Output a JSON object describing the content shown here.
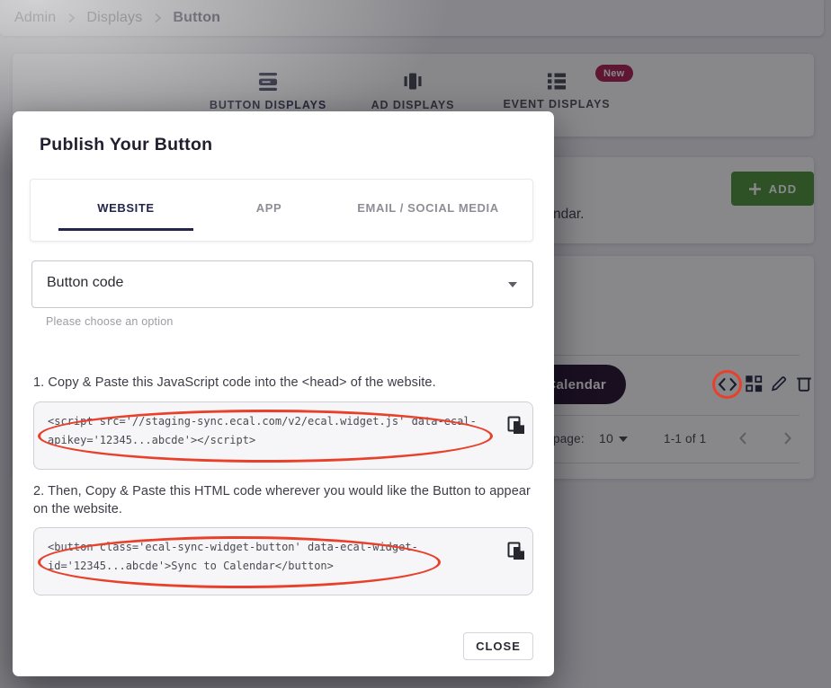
{
  "colors": {
    "accent_navy": "#23254c",
    "badge_red": "#ad1a4d",
    "add_green": "#4a9132",
    "annotation_red": "#e8402a",
    "pill_dark": "#200d2b"
  },
  "breadcrumb": {
    "items": [
      "Admin",
      "Displays",
      "Button"
    ]
  },
  "display_tabs": {
    "button": {
      "label": "BUTTON DISPLAYS"
    },
    "ad": {
      "label": "AD DISPLAYS"
    },
    "event": {
      "label": "EVENT DISPLAYS",
      "badge": "New"
    }
  },
  "background": {
    "add_button_label": "ADD",
    "hidden_text_fragment": "ndar.",
    "row_button_label": "Calendar",
    "pagination": {
      "label_fragment": "page:",
      "page_size": "10",
      "range": "1-1 of 1"
    }
  },
  "modal": {
    "title": "Publish Your Button",
    "tabs": {
      "website": "WEBSITE",
      "app": "APP",
      "email": "EMAIL / SOCIAL MEDIA"
    },
    "select": {
      "value": "Button code",
      "helper": "Please choose an option"
    },
    "step1": {
      "instruction": "1. Copy & Paste this JavaScript code into the <head> of the website.",
      "code": "<script src='//staging-sync.ecal.com/v2/ecal.widget.js' data-ecal-\napikey='12345...abcde'></script>"
    },
    "step2": {
      "instruction": "2. Then, Copy & Paste this HTML code wherever you would like the Button to appear on the website.",
      "code": "<button class='ecal-sync-widget-button' data-ecal-widget-\nid='12345...abcde'>Sync to Calendar</button>"
    },
    "close_label": "CLOSE"
  }
}
